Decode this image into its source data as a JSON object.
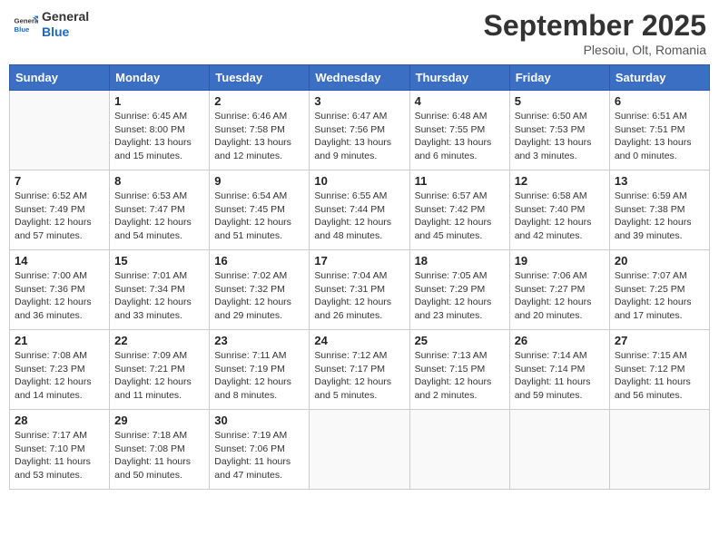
{
  "header": {
    "logo_general": "General",
    "logo_blue": "Blue",
    "month_title": "September 2025",
    "location": "Plesoiu, Olt, Romania"
  },
  "days_of_week": [
    "Sunday",
    "Monday",
    "Tuesday",
    "Wednesday",
    "Thursday",
    "Friday",
    "Saturday"
  ],
  "weeks": [
    [
      {
        "day": "",
        "info": ""
      },
      {
        "day": "1",
        "info": "Sunrise: 6:45 AM\nSunset: 8:00 PM\nDaylight: 13 hours\nand 15 minutes."
      },
      {
        "day": "2",
        "info": "Sunrise: 6:46 AM\nSunset: 7:58 PM\nDaylight: 13 hours\nand 12 minutes."
      },
      {
        "day": "3",
        "info": "Sunrise: 6:47 AM\nSunset: 7:56 PM\nDaylight: 13 hours\nand 9 minutes."
      },
      {
        "day": "4",
        "info": "Sunrise: 6:48 AM\nSunset: 7:55 PM\nDaylight: 13 hours\nand 6 minutes."
      },
      {
        "day": "5",
        "info": "Sunrise: 6:50 AM\nSunset: 7:53 PM\nDaylight: 13 hours\nand 3 minutes."
      },
      {
        "day": "6",
        "info": "Sunrise: 6:51 AM\nSunset: 7:51 PM\nDaylight: 13 hours\nand 0 minutes."
      }
    ],
    [
      {
        "day": "7",
        "info": "Sunrise: 6:52 AM\nSunset: 7:49 PM\nDaylight: 12 hours\nand 57 minutes."
      },
      {
        "day": "8",
        "info": "Sunrise: 6:53 AM\nSunset: 7:47 PM\nDaylight: 12 hours\nand 54 minutes."
      },
      {
        "day": "9",
        "info": "Sunrise: 6:54 AM\nSunset: 7:45 PM\nDaylight: 12 hours\nand 51 minutes."
      },
      {
        "day": "10",
        "info": "Sunrise: 6:55 AM\nSunset: 7:44 PM\nDaylight: 12 hours\nand 48 minutes."
      },
      {
        "day": "11",
        "info": "Sunrise: 6:57 AM\nSunset: 7:42 PM\nDaylight: 12 hours\nand 45 minutes."
      },
      {
        "day": "12",
        "info": "Sunrise: 6:58 AM\nSunset: 7:40 PM\nDaylight: 12 hours\nand 42 minutes."
      },
      {
        "day": "13",
        "info": "Sunrise: 6:59 AM\nSunset: 7:38 PM\nDaylight: 12 hours\nand 39 minutes."
      }
    ],
    [
      {
        "day": "14",
        "info": "Sunrise: 7:00 AM\nSunset: 7:36 PM\nDaylight: 12 hours\nand 36 minutes."
      },
      {
        "day": "15",
        "info": "Sunrise: 7:01 AM\nSunset: 7:34 PM\nDaylight: 12 hours\nand 33 minutes."
      },
      {
        "day": "16",
        "info": "Sunrise: 7:02 AM\nSunset: 7:32 PM\nDaylight: 12 hours\nand 29 minutes."
      },
      {
        "day": "17",
        "info": "Sunrise: 7:04 AM\nSunset: 7:31 PM\nDaylight: 12 hours\nand 26 minutes."
      },
      {
        "day": "18",
        "info": "Sunrise: 7:05 AM\nSunset: 7:29 PM\nDaylight: 12 hours\nand 23 minutes."
      },
      {
        "day": "19",
        "info": "Sunrise: 7:06 AM\nSunset: 7:27 PM\nDaylight: 12 hours\nand 20 minutes."
      },
      {
        "day": "20",
        "info": "Sunrise: 7:07 AM\nSunset: 7:25 PM\nDaylight: 12 hours\nand 17 minutes."
      }
    ],
    [
      {
        "day": "21",
        "info": "Sunrise: 7:08 AM\nSunset: 7:23 PM\nDaylight: 12 hours\nand 14 minutes."
      },
      {
        "day": "22",
        "info": "Sunrise: 7:09 AM\nSunset: 7:21 PM\nDaylight: 12 hours\nand 11 minutes."
      },
      {
        "day": "23",
        "info": "Sunrise: 7:11 AM\nSunset: 7:19 PM\nDaylight: 12 hours\nand 8 minutes."
      },
      {
        "day": "24",
        "info": "Sunrise: 7:12 AM\nSunset: 7:17 PM\nDaylight: 12 hours\nand 5 minutes."
      },
      {
        "day": "25",
        "info": "Sunrise: 7:13 AM\nSunset: 7:15 PM\nDaylight: 12 hours\nand 2 minutes."
      },
      {
        "day": "26",
        "info": "Sunrise: 7:14 AM\nSunset: 7:14 PM\nDaylight: 11 hours\nand 59 minutes."
      },
      {
        "day": "27",
        "info": "Sunrise: 7:15 AM\nSunset: 7:12 PM\nDaylight: 11 hours\nand 56 minutes."
      }
    ],
    [
      {
        "day": "28",
        "info": "Sunrise: 7:17 AM\nSunset: 7:10 PM\nDaylight: 11 hours\nand 53 minutes."
      },
      {
        "day": "29",
        "info": "Sunrise: 7:18 AM\nSunset: 7:08 PM\nDaylight: 11 hours\nand 50 minutes."
      },
      {
        "day": "30",
        "info": "Sunrise: 7:19 AM\nSunset: 7:06 PM\nDaylight: 11 hours\nand 47 minutes."
      },
      {
        "day": "",
        "info": ""
      },
      {
        "day": "",
        "info": ""
      },
      {
        "day": "",
        "info": ""
      },
      {
        "day": "",
        "info": ""
      }
    ]
  ]
}
